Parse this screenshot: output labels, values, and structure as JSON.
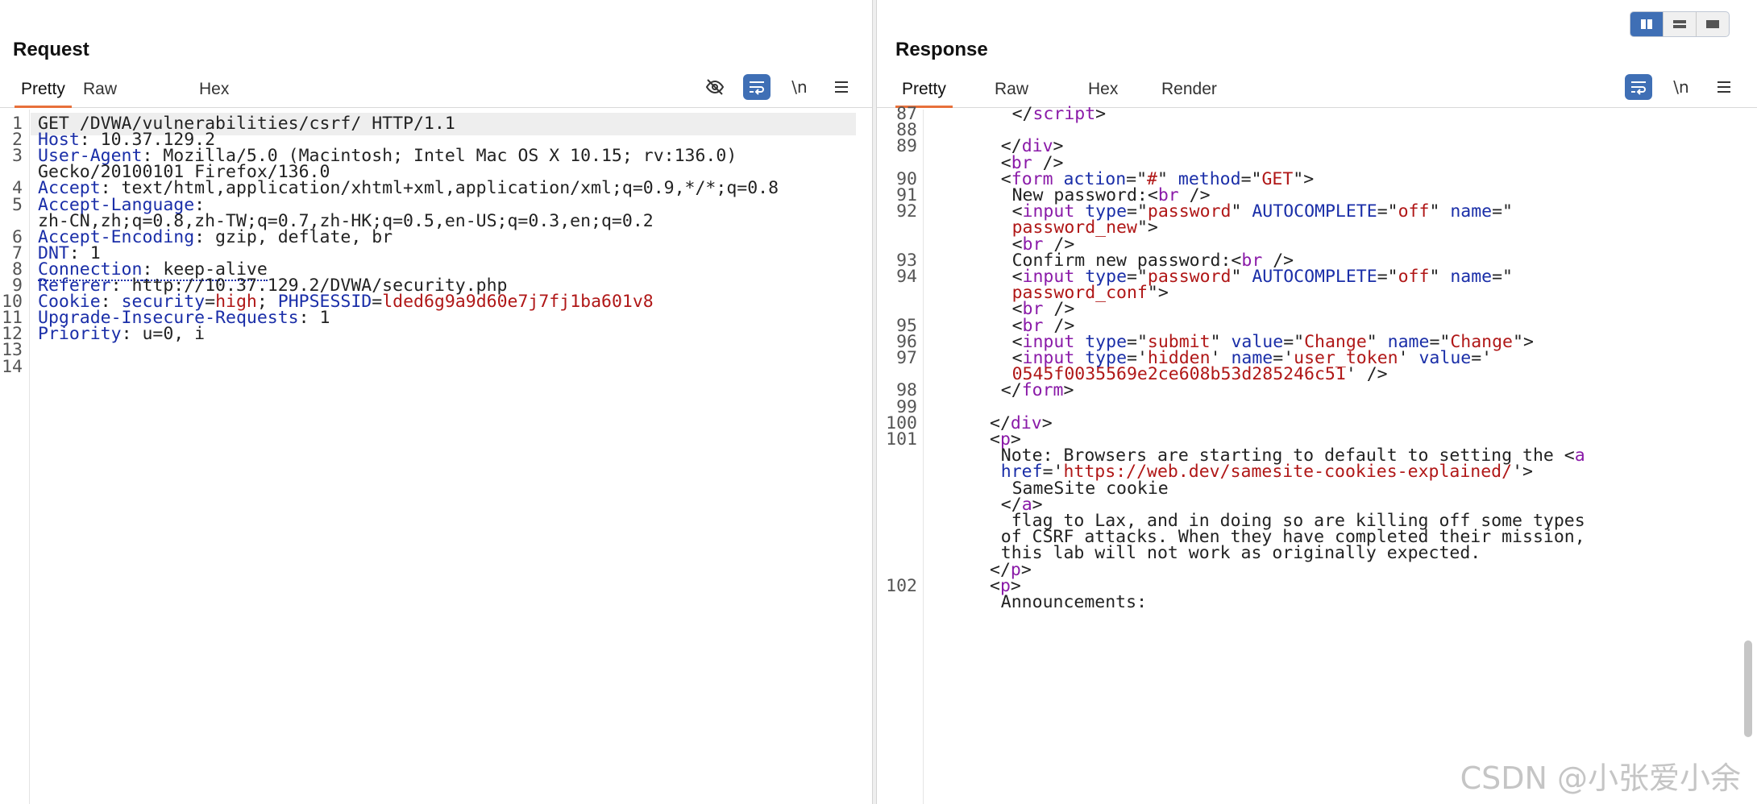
{
  "request": {
    "title": "Request",
    "tabs": [
      "Pretty",
      "Raw",
      "Hex"
    ],
    "active_tab": "Pretty",
    "toolbar": {
      "hide_icon": "eye-off-icon",
      "wrap_icon": "wrap-lines-icon",
      "newline_label": "\\n",
      "menu_icon": "hamburger-menu-icon"
    },
    "lines": [
      {
        "n": "1",
        "parts": [
          [
            "v",
            "GET /DVWA/vulnerabilities/csrf/ HTTP/1.1"
          ]
        ]
      },
      {
        "n": "2",
        "parts": [
          [
            "k",
            "Host"
          ],
          [
            "v",
            ": 10.37.129.2"
          ]
        ]
      },
      {
        "n": "3",
        "parts": [
          [
            "k",
            "User-Agent"
          ],
          [
            "v",
            ": Mozilla/5.0 (Macintosh; Intel Mac OS X 10.15; rv:136.0)"
          ]
        ]
      },
      {
        "n": "",
        "parts": [
          [
            "v",
            "Gecko/20100101 Firefox/136.0"
          ]
        ]
      },
      {
        "n": "4",
        "parts": [
          [
            "k",
            "Accept"
          ],
          [
            "v",
            ": text/html,application/xhtml+xml,application/xml;q=0.9,*/*;q=0.8"
          ]
        ]
      },
      {
        "n": "5",
        "parts": [
          [
            "k",
            "Accept-Language"
          ],
          [
            "v",
            ":"
          ]
        ]
      },
      {
        "n": "",
        "parts": [
          [
            "v",
            "zh-CN,zh;q=0.8,zh-TW;q=0.7,zh-HK;q=0.5,en-US;q=0.3,en;q=0.2"
          ]
        ]
      },
      {
        "n": "6",
        "parts": [
          [
            "k",
            "Accept-Encoding"
          ],
          [
            "v",
            ": gzip, deflate, br"
          ]
        ]
      },
      {
        "n": "7",
        "parts": [
          [
            "k",
            "DNT"
          ],
          [
            "v",
            ": 1"
          ]
        ]
      },
      {
        "n": "8",
        "parts": [
          [
            "kd",
            "Connection"
          ],
          [
            "vd",
            ": keep-alive"
          ]
        ]
      },
      {
        "n": "9",
        "parts": [
          [
            "k",
            "Referer"
          ],
          [
            "v",
            ": http://10.37.129.2/DVWA/security.php"
          ]
        ]
      },
      {
        "n": "10",
        "parts": [
          [
            "k",
            "Cookie"
          ],
          [
            "v",
            ": "
          ],
          [
            "k",
            "security"
          ],
          [
            "v",
            "="
          ],
          [
            "str",
            "high"
          ],
          [
            "v",
            "; "
          ],
          [
            "k",
            "PHPSESSID"
          ],
          [
            "v",
            "="
          ],
          [
            "str",
            "lded6g9a9d60e7j7fj1ba601v8"
          ]
        ]
      },
      {
        "n": "11",
        "parts": [
          [
            "k",
            "Upgrade-Insecure-Requests"
          ],
          [
            "v",
            ": 1"
          ]
        ]
      },
      {
        "n": "12",
        "parts": [
          [
            "k",
            "Priority"
          ],
          [
            "v",
            ": u=0, i"
          ]
        ]
      },
      {
        "n": "13",
        "parts": []
      },
      {
        "n": "14",
        "parts": []
      }
    ]
  },
  "response": {
    "title": "Response",
    "tabs": [
      "Pretty",
      "Raw",
      "Hex",
      "Render"
    ],
    "active_tab": "Pretty",
    "toolbar": {
      "wrap_icon": "wrap-lines-icon",
      "newline_label": "\\n",
      "menu_icon": "hamburger-menu-icon"
    },
    "lines": [
      {
        "n": "87",
        "indent": 7,
        "parts": [
          [
            "v",
            "</"
          ],
          [
            "tag",
            "script"
          ],
          [
            "v",
            ">"
          ]
        ]
      },
      {
        "n": "88",
        "indent": 0,
        "parts": []
      },
      {
        "n": "89",
        "indent": 6,
        "parts": [
          [
            "v",
            "</"
          ],
          [
            "tag",
            "div"
          ],
          [
            "v",
            ">"
          ]
        ]
      },
      {
        "n": "",
        "indent": 6,
        "parts": [
          [
            "v",
            "<"
          ],
          [
            "tag",
            "br"
          ],
          [
            "v",
            " />"
          ]
        ]
      },
      {
        "n": "90",
        "indent": 6,
        "parts": [
          [
            "v",
            "<"
          ],
          [
            "tag",
            "form"
          ],
          [
            "v",
            " "
          ],
          [
            "k",
            "action"
          ],
          [
            "v",
            "=\""
          ],
          [
            "str",
            "#"
          ],
          [
            "v",
            "\" "
          ],
          [
            "k",
            "method"
          ],
          [
            "v",
            "=\""
          ],
          [
            "str",
            "GET"
          ],
          [
            "v",
            "\">"
          ]
        ]
      },
      {
        "n": "91",
        "indent": 7,
        "parts": [
          [
            "v",
            "New password:<"
          ],
          [
            "tag",
            "br"
          ],
          [
            "v",
            " />"
          ]
        ]
      },
      {
        "n": "92",
        "indent": 7,
        "parts": [
          [
            "v",
            "<"
          ],
          [
            "tag",
            "input"
          ],
          [
            "v",
            " "
          ],
          [
            "k",
            "type"
          ],
          [
            "v",
            "=\""
          ],
          [
            "str",
            "password"
          ],
          [
            "v",
            "\" "
          ],
          [
            "k",
            "AUTOCOMPLETE"
          ],
          [
            "v",
            "=\""
          ],
          [
            "str",
            "off"
          ],
          [
            "v",
            "\" "
          ],
          [
            "k",
            "name"
          ],
          [
            "v",
            "=\""
          ]
        ]
      },
      {
        "n": "",
        "indent": 7,
        "parts": [
          [
            "str",
            "password_new"
          ],
          [
            "v",
            "\">"
          ]
        ]
      },
      {
        "n": "",
        "indent": 7,
        "parts": [
          [
            "v",
            "<"
          ],
          [
            "tag",
            "br"
          ],
          [
            "v",
            " />"
          ]
        ]
      },
      {
        "n": "93",
        "indent": 7,
        "parts": [
          [
            "v",
            "Confirm new password:<"
          ],
          [
            "tag",
            "br"
          ],
          [
            "v",
            " />"
          ]
        ]
      },
      {
        "n": "94",
        "indent": 7,
        "parts": [
          [
            "v",
            "<"
          ],
          [
            "tag",
            "input"
          ],
          [
            "v",
            " "
          ],
          [
            "k",
            "type"
          ],
          [
            "v",
            "=\""
          ],
          [
            "str",
            "password"
          ],
          [
            "v",
            "\" "
          ],
          [
            "k",
            "AUTOCOMPLETE"
          ],
          [
            "v",
            "=\""
          ],
          [
            "str",
            "off"
          ],
          [
            "v",
            "\" "
          ],
          [
            "k",
            "name"
          ],
          [
            "v",
            "=\""
          ]
        ]
      },
      {
        "n": "",
        "indent": 7,
        "parts": [
          [
            "str",
            "password_conf"
          ],
          [
            "v",
            "\">"
          ]
        ]
      },
      {
        "n": "",
        "indent": 7,
        "parts": [
          [
            "v",
            "<"
          ],
          [
            "tag",
            "br"
          ],
          [
            "v",
            " />"
          ]
        ]
      },
      {
        "n": "95",
        "indent": 7,
        "parts": [
          [
            "v",
            "<"
          ],
          [
            "tag",
            "br"
          ],
          [
            "v",
            " />"
          ]
        ]
      },
      {
        "n": "96",
        "indent": 7,
        "parts": [
          [
            "v",
            "<"
          ],
          [
            "tag",
            "input"
          ],
          [
            "v",
            " "
          ],
          [
            "k",
            "type"
          ],
          [
            "v",
            "=\""
          ],
          [
            "str",
            "submit"
          ],
          [
            "v",
            "\" "
          ],
          [
            "k",
            "value"
          ],
          [
            "v",
            "=\""
          ],
          [
            "str",
            "Change"
          ],
          [
            "v",
            "\" "
          ],
          [
            "k",
            "name"
          ],
          [
            "v",
            "=\""
          ],
          [
            "str",
            "Change"
          ],
          [
            "v",
            "\">"
          ]
        ]
      },
      {
        "n": "97",
        "indent": 7,
        "parts": [
          [
            "v",
            "<"
          ],
          [
            "tag",
            "input"
          ],
          [
            "v",
            " "
          ],
          [
            "k",
            "type"
          ],
          [
            "v",
            "='"
          ],
          [
            "str",
            "hidden"
          ],
          [
            "v",
            "' "
          ],
          [
            "k",
            "name"
          ],
          [
            "v",
            "='"
          ],
          [
            "str",
            "user_token"
          ],
          [
            "v",
            "' "
          ],
          [
            "k",
            "value"
          ],
          [
            "v",
            "='"
          ]
        ]
      },
      {
        "n": "",
        "indent": 7,
        "parts": [
          [
            "str",
            "0545f0035569e2ce608b53d285246c51"
          ],
          [
            "v",
            "' />"
          ]
        ]
      },
      {
        "n": "98",
        "indent": 6,
        "parts": [
          [
            "v",
            "</"
          ],
          [
            "tag",
            "form"
          ],
          [
            "v",
            ">"
          ]
        ]
      },
      {
        "n": "99",
        "indent": 0,
        "parts": []
      },
      {
        "n": "100",
        "indent": 5,
        "parts": [
          [
            "v",
            "</"
          ],
          [
            "tag",
            "div"
          ],
          [
            "v",
            ">"
          ]
        ]
      },
      {
        "n": "101",
        "indent": 5,
        "parts": [
          [
            "v",
            "<"
          ],
          [
            "tag",
            "p"
          ],
          [
            "v",
            ">"
          ]
        ]
      },
      {
        "n": "",
        "indent": 6,
        "parts": [
          [
            "v",
            "Note: Browsers are starting to default to setting the <"
          ],
          [
            "tag",
            "a"
          ]
        ]
      },
      {
        "n": "",
        "indent": 6,
        "parts": [
          [
            "k",
            "href"
          ],
          [
            "v",
            "='"
          ],
          [
            "str",
            "https://web.dev/samesite-cookies-explained/"
          ],
          [
            "v",
            "'>"
          ]
        ]
      },
      {
        "n": "",
        "indent": 7,
        "parts": [
          [
            "v",
            "SameSite cookie"
          ]
        ]
      },
      {
        "n": "",
        "indent": 6,
        "parts": [
          [
            "v",
            "</"
          ],
          [
            "tag",
            "a"
          ],
          [
            "v",
            ">"
          ]
        ]
      },
      {
        "n": "",
        "indent": 6,
        "parts": [
          [
            "v",
            " flag to Lax, and in doing so are killing off some types"
          ]
        ]
      },
      {
        "n": "",
        "indent": 6,
        "parts": [
          [
            "v",
            "of CSRF attacks. When they have completed their mission,"
          ]
        ]
      },
      {
        "n": "",
        "indent": 6,
        "parts": [
          [
            "v",
            "this lab will not work as originally expected."
          ]
        ]
      },
      {
        "n": "",
        "indent": 5,
        "parts": [
          [
            "v",
            "</"
          ],
          [
            "tag",
            "p"
          ],
          [
            "v",
            ">"
          ]
        ]
      },
      {
        "n": "102",
        "indent": 5,
        "parts": [
          [
            "v",
            "<"
          ],
          [
            "tag",
            "p"
          ],
          [
            "v",
            ">"
          ]
        ]
      },
      {
        "n": "",
        "indent": 6,
        "parts": [
          [
            "v",
            "Announcements:"
          ]
        ]
      }
    ]
  },
  "layout_switcher": {
    "options": [
      "split-vertical-icon",
      "split-horizontal-icon",
      "single-pane-icon"
    ],
    "active": "split-vertical-icon"
  },
  "watermark": "CSDN @小张爱小余",
  "colors": {
    "accent_tab": "#e8703a",
    "button_blue": "#3f6fb5",
    "key": "#1a2ea8",
    "tag": "#8a1aa8",
    "string": "#b01717"
  }
}
